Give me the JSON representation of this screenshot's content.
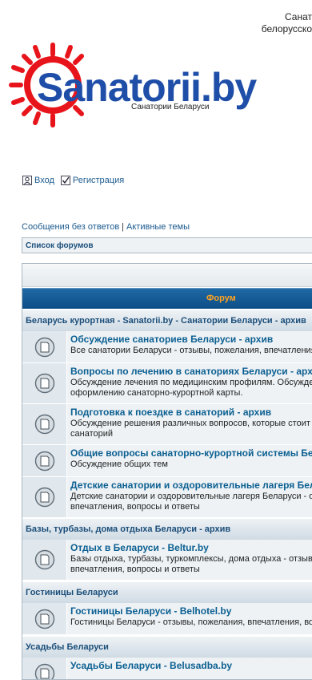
{
  "header": {
    "tagline_line1": "Санат",
    "tagline_line2": "белорусско"
  },
  "logo": {
    "brand": "Sanatorii.by",
    "subtitle": "Санатории Беларуси",
    "colors": {
      "sun": "#e8141b",
      "text": "#1e4ea8"
    }
  },
  "userbar": {
    "login": "Вход",
    "register": "Регистрация"
  },
  "searchbar": {
    "unanswered": "Сообщения без ответов",
    "separator": "|",
    "active": "Активные темы"
  },
  "nav": {
    "forum_index": "Список форумов"
  },
  "table": {
    "column_header": "Форум",
    "sections": [
      {
        "title": "Беларусь курортная - Sanatorii.by - Санатории Беларуси - архив",
        "forums": [
          {
            "title": "Обсуждение санаториев Беларуси - архив",
            "desc": [
              "Все санатории Беларуси - отзывы, пожелания, впечатления"
            ]
          },
          {
            "title": "Вопросы по лечению в санаториях Беларуси - арх",
            "desc": [
              "Обсуждение лечения по медицинским профилям. Обсужде",
              "оформлению санаторно-курортной карты."
            ]
          },
          {
            "title": "Подготовка к поездке в санаторий - архив",
            "desc": [
              "Обсуждение решения различных вопросов, которые стоит",
              "санаторий"
            ]
          },
          {
            "title": "Общие вопросы санаторно-курортной системы Бе",
            "desc": [
              "Обсуждение общих тем"
            ]
          },
          {
            "title": "Детские санатории и оздоровительные лагеря Бел",
            "desc": [
              "Детские санатории и оздоровительные лагеря Беларуси - о",
              "впечатления, вопросы и ответы"
            ]
          }
        ]
      },
      {
        "title": "Базы, турбазы, дома отдыха Беларуси - архив",
        "forums": [
          {
            "title": "Отдых в Беларуси - Beltur.by",
            "desc": [
              "Базы отдыха, турбазы, туркомплексы, дома отдыха - отзыв",
              "впечатления, вопросы и ответы"
            ]
          }
        ]
      },
      {
        "title": "Гостиницы Беларуси",
        "forums": [
          {
            "title": "Гостиницы Беларуси - Belhotel.by",
            "desc": [
              "Гостиницы Беларуси - отзывы, пожелания, впечатления, во"
            ]
          }
        ]
      },
      {
        "title": "Усадьбы Беларуси",
        "forums": [
          {
            "title": "Усадьбы Беларуси - Belusadba.by",
            "desc": [
              ""
            ]
          }
        ]
      }
    ]
  }
}
